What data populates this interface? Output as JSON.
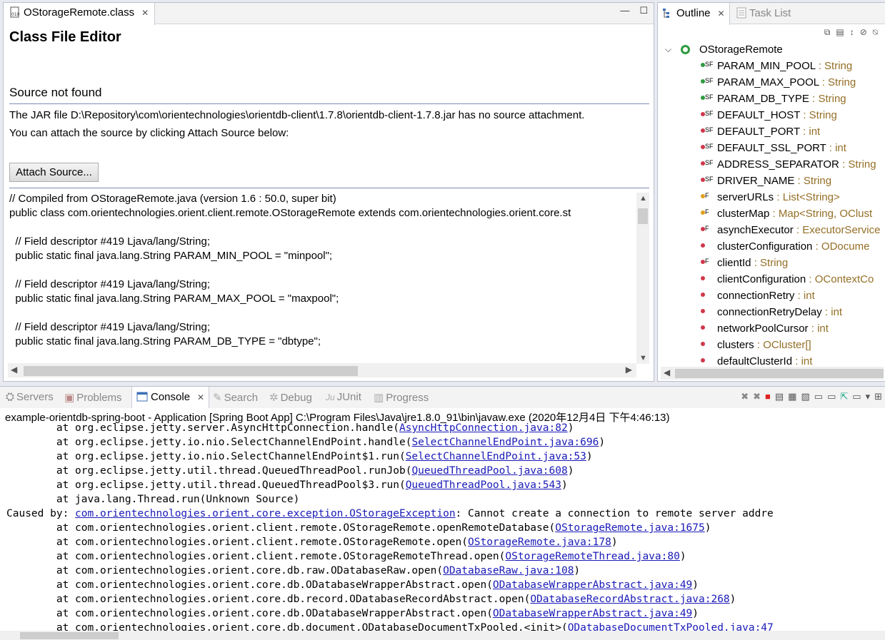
{
  "editor": {
    "tab_title": "OStorageRemote.class",
    "heading": "Class File Editor",
    "source_not_found": "Source not found",
    "message_line1": "The JAR file D:\\Repository\\com\\orientechnologies\\orientdb-client\\1.7.8\\orientdb-client-1.7.8.jar has no source attachment.",
    "message_line2": "You can attach the source by clicking Attach Source below:",
    "attach_button": "Attach Source...",
    "code_lines": [
      "// Compiled from OStorageRemote.java (version 1.6 : 50.0, super bit)",
      "public class com.orientechnologies.orient.client.remote.OStorageRemote extends com.orientechnologies.orient.core.st",
      "",
      "  // Field descriptor #419 Ljava/lang/String;",
      "  public static final java.lang.String PARAM_MIN_POOL = \"minpool\";",
      "",
      "  // Field descriptor #419 Ljava/lang/String;",
      "  public static final java.lang.String PARAM_MAX_POOL = \"maxpool\";",
      "",
      "  // Field descriptor #419 Ljava/lang/String;",
      "  public static final java.lang.String PARAM_DB_TYPE = \"dbtype\";"
    ]
  },
  "outline": {
    "tab_outline": "Outline",
    "tab_tasklist": "Task List",
    "root": "OStorageRemote",
    "items": [
      {
        "name": "PARAM_MIN_POOL",
        "type": ": String",
        "mods": "SF",
        "color": "#2e9b3f"
      },
      {
        "name": "PARAM_MAX_POOL",
        "type": ": String",
        "mods": "SF",
        "color": "#2e9b3f"
      },
      {
        "name": "PARAM_DB_TYPE",
        "type": ": String",
        "mods": "SF",
        "color": "#2e9b3f"
      },
      {
        "name": "DEFAULT_HOST",
        "type": ": String",
        "mods": "SF",
        "color": "#d0384b"
      },
      {
        "name": "DEFAULT_PORT",
        "type": ": int",
        "mods": "SF",
        "color": "#d0384b"
      },
      {
        "name": "DEFAULT_SSL_PORT",
        "type": ": int",
        "mods": "SF",
        "color": "#d0384b"
      },
      {
        "name": "ADDRESS_SEPARATOR",
        "type": ": String",
        "mods": "SF",
        "color": "#d0384b"
      },
      {
        "name": "DRIVER_NAME",
        "type": ": String",
        "mods": "SF",
        "color": "#d0384b"
      },
      {
        "name": "serverURLs",
        "type": ": List<String>",
        "mods": "F",
        "color": "#e0a020"
      },
      {
        "name": "clusterMap",
        "type": ": Map<String, OClust",
        "mods": "F",
        "color": "#e0a020"
      },
      {
        "name": "asynchExecutor",
        "type": ": ExecutorService",
        "mods": "F",
        "color": "#d0384b"
      },
      {
        "name": "clusterConfiguration",
        "type": ": ODocume",
        "mods": "",
        "color": "#d0384b"
      },
      {
        "name": "clientId",
        "type": ": String",
        "mods": "F",
        "color": "#d0384b"
      },
      {
        "name": "clientConfiguration",
        "type": ": OContextCo",
        "mods": "",
        "color": "#d0384b"
      },
      {
        "name": "connectionRetry",
        "type": ": int",
        "mods": "",
        "color": "#d0384b"
      },
      {
        "name": "connectionRetryDelay",
        "type": ": int",
        "mods": "",
        "color": "#d0384b"
      },
      {
        "name": "networkPoolCursor",
        "type": ": int",
        "mods": "",
        "color": "#d0384b"
      },
      {
        "name": "clusters",
        "type": ": OCluster[]",
        "mods": "",
        "color": "#d0384b"
      },
      {
        "name": "defaultClusterId",
        "type": ": int",
        "mods": "",
        "color": "#d0384b"
      }
    ]
  },
  "console": {
    "tabs": [
      "Servers",
      "Problems",
      "Console",
      "Search",
      "Debug",
      "JUnit",
      "Progress"
    ],
    "active_tab": "Console",
    "description": "example-orientdb-spring-boot - Application [Spring Boot App] C:\\Program Files\\Java\\jre1.8.0_91\\bin\\javaw.exe (2020年12月4日 下午4:46:13)",
    "lines": [
      {
        "pre": "        at org.eclipse.jetty.server.AsyncHttpConnection.handle(",
        "link": "AsyncHttpConnection.java:82",
        "post": ")"
      },
      {
        "pre": "        at org.eclipse.jetty.io.nio.SelectChannelEndPoint.handle(",
        "link": "SelectChannelEndPoint.java:696",
        "post": ")"
      },
      {
        "pre": "        at org.eclipse.jetty.io.nio.SelectChannelEndPoint$1.run(",
        "link": "SelectChannelEndPoint.java:53",
        "post": ")"
      },
      {
        "pre": "        at org.eclipse.jetty.util.thread.QueuedThreadPool.runJob(",
        "link": "QueuedThreadPool.java:608",
        "post": ")"
      },
      {
        "pre": "        at org.eclipse.jetty.util.thread.QueuedThreadPool$3.run(",
        "link": "QueuedThreadPool.java:543",
        "post": ")"
      },
      {
        "pre": "        at java.lang.Thread.run(Unknown Source)",
        "link": "",
        "post": ""
      },
      {
        "pre": "Caused by: ",
        "link": "com.orientechnologies.orient.core.exception.OStorageException",
        "post": ": Cannot create a connection to remote server addre"
      },
      {
        "pre": "        at com.orientechnologies.orient.client.remote.OStorageRemote.openRemoteDatabase(",
        "link": "OStorageRemote.java:1675",
        "post": ")"
      },
      {
        "pre": "        at com.orientechnologies.orient.client.remote.OStorageRemote.open(",
        "link": "OStorageRemote.java:178",
        "post": ")"
      },
      {
        "pre": "        at com.orientechnologies.orient.client.remote.OStorageRemoteThread.open(",
        "link": "OStorageRemoteThread.java:80",
        "post": ")"
      },
      {
        "pre": "        at com.orientechnologies.orient.core.db.raw.ODatabaseRaw.open(",
        "link": "ODatabaseRaw.java:108",
        "post": ")"
      },
      {
        "pre": "        at com.orientechnologies.orient.core.db.ODatabaseWrapperAbstract.open(",
        "link": "ODatabaseWrapperAbstract.java:49",
        "post": ")"
      },
      {
        "pre": "        at com.orientechnologies.orient.core.db.record.ODatabaseRecordAbstract.open(",
        "link": "ODatabaseRecordAbstract.java:268",
        "post": ")"
      },
      {
        "pre": "        at com.orientechnologies.orient.core.db.ODatabaseWrapperAbstract.open(",
        "link": "ODatabaseWrapperAbstract.java:49",
        "post": ")"
      },
      {
        "pre": "        at com.orientechnologies.orient.core.db.document.ODatabaseDocumentTxPooled.<init>(",
        "link": "ODatabaseDocumentTxPooled.java:47",
        "post": ""
      }
    ]
  }
}
